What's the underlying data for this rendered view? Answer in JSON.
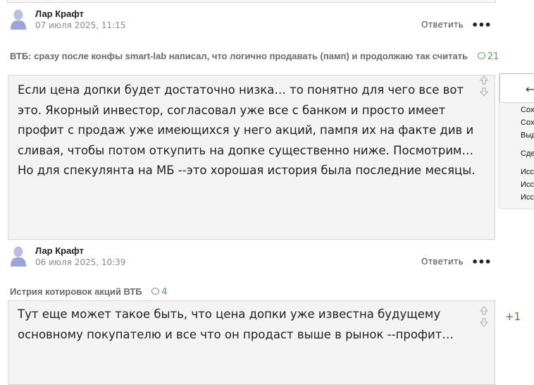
{
  "comments": [
    {
      "author": "Лар Крафт",
      "date": "07 июля 2025, 11:15",
      "reply": "Ответить",
      "more": "•••",
      "post_title": "ВТБ: сразу после конфы smart-lab написал, что логично продавать (памп) и продолжаю так считать",
      "comment_count": "21",
      "body": "Если цена допки будет достаточно  низка… то понятно для чего все вот это. Якорный инвестор, согласовал уже все с банком  и просто имеет профит с продаж уже имеющихся у него акций, пампя их на факте див и сливая, чтобы потом откупить на допке существенно ниже. Посмотрим…\nНо для спекулянта на МБ --это хорошая история была последние месяцы."
    },
    {
      "author": "Лар Крафт",
      "date": "06 июля 2025, 10:39",
      "reply": "Ответить",
      "more": "•••",
      "post_title": "Истрия котировок акций ВТБ",
      "comment_count": "4",
      "body": "Тут еще может такое быть, что цена допки уже известна будущему основному покупателю и все что он продаст выше в рынок --профит…",
      "score": "+1"
    }
  ],
  "side_menu": {
    "items": [
      "Сох",
      "Сох",
      "Выд",
      "Сде",
      "Исс",
      "Исс",
      "Исс"
    ]
  },
  "colors": {
    "accent_green": "#5a9c5a",
    "score_green": "#3a8a3a",
    "box_background": "#f3f3f3"
  },
  "icons": [
    "user-avatar-icon",
    "comment-bubble-icon",
    "vote-up-icon",
    "vote-down-icon",
    "back-arrow-icon"
  ]
}
